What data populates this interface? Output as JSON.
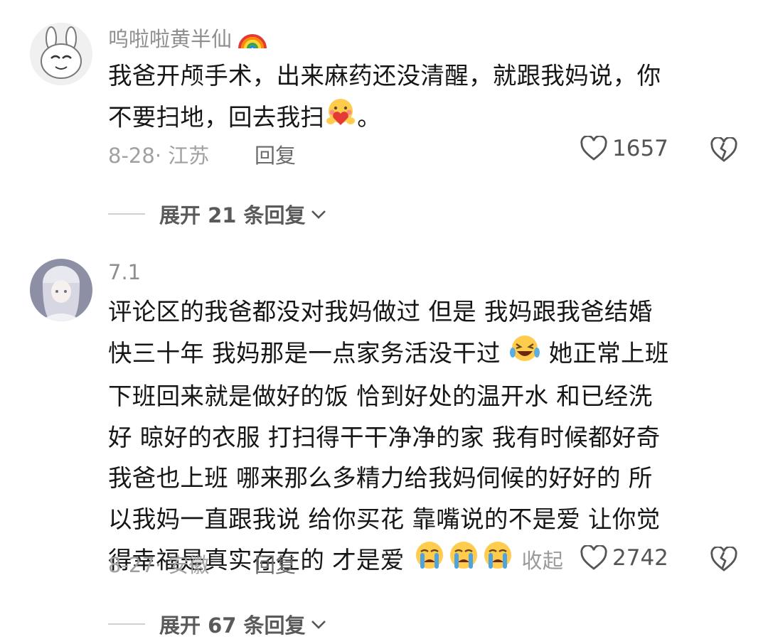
{
  "comments": [
    {
      "username": "呜啦啦黄半仙",
      "username_emoji": "rainbow-emoji",
      "text_line1": "我爸开颅手术，出来麻药还没清醒，就跟我妈说，你",
      "text_line2_a": "不要扫地，回去我扫",
      "text_line2_b": "。",
      "inline_emoji": "heart-hug-emoji",
      "date_location": "8-28· 江苏",
      "reply_label": "回复",
      "likes": "1657",
      "expand_label": "展开 21 条回复"
    },
    {
      "username": "7.1",
      "text_lines": [
        "评论区的我爸都没对我妈做过 但是 我妈跟我爸结婚",
        "快三十年 我妈那是一点家务活没干过",
        "她正常上班",
        "下班回来就是做好的饭 恰到好处的温开水 和已经洗",
        "好 晾好的衣服 打扫得干干净净的家 我有时候都好奇",
        "我爸也上班 哪来那么多精力给我妈伺候的好好的 所",
        "以我妈一直跟我说 给你买花 靠嘴说的不是爱  让你觉",
        "得幸福是真实存在的 才是爱"
      ],
      "collapse_label": "收起",
      "date_location": "8-27· 安徽",
      "reply_label": "回复",
      "likes": "2742",
      "expand_label": "展开 67 条回复"
    }
  ],
  "colors": {
    "text": "#161616",
    "muted": "#a0a0a0",
    "background": "#ffffff"
  }
}
